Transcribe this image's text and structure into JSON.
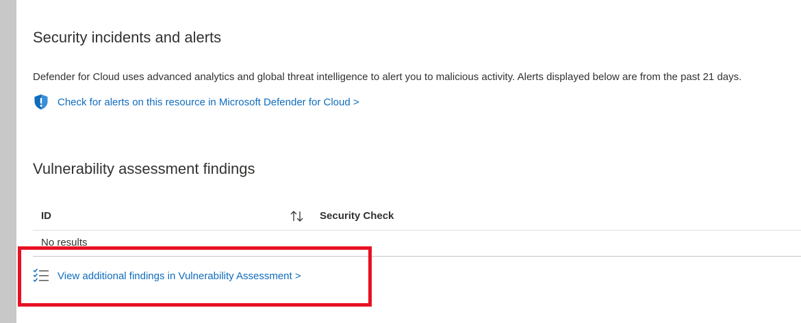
{
  "security": {
    "title": "Security incidents and alerts",
    "description": "Defender for Cloud uses advanced analytics and global threat intelligence to alert you to malicious activity. Alerts displayed below are from the past 21 days.",
    "link_label": "Check for alerts on this resource in Microsoft Defender for Cloud >",
    "link_icon": "shield-alert-icon"
  },
  "vulnerability": {
    "title": "Vulnerability assessment findings",
    "columns": [
      "ID",
      "Security Check"
    ],
    "empty_text": "No results",
    "link_label": "View additional findings in Vulnerability Assessment >",
    "link_icon": "checklist-icon"
  },
  "colors": {
    "link": "#0f6cbd",
    "highlight": "#e81123",
    "rail": "#c8c8c8"
  }
}
